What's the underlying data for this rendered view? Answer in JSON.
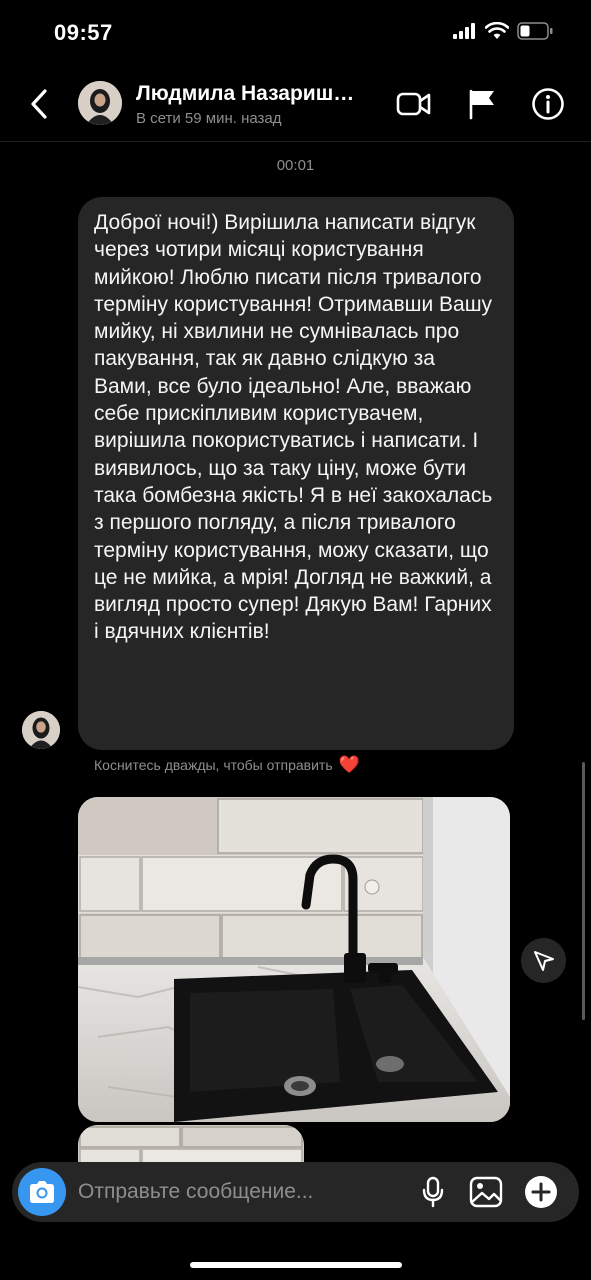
{
  "status_bar": {
    "time": "09:57"
  },
  "header": {
    "name": "Людмила Назариш…",
    "status": "В сети 59 мин. назад"
  },
  "chat": {
    "timestamp": "00:01",
    "message": "Доброї ночі!) Вирішила написати відгук через чотири місяці користування мийкою! Люблю писати після тривалого терміну користування! Отримавши Вашу мийку, ні хвилини не сумнівалась про пакування, так як давно слідкую за Вами, все було ідеально! Але, вважаю себе прискіпливим користувачем, вирішила покористуватись і написати. І виявилось, що за таку ціну, може бути така бомбезна якість! Я в неї закохалась з першого погляду, а після тривалого терміну користування, можу сказати, що це не мийка, а мрія! Догляд  не важкий, а вигляд просто супер! Дякую Вам! Гарних і вдячних клієнтів!",
    "double_tap_hint": "Коснитесь дважды, чтобы отправить",
    "hint_heart": "❤️"
  },
  "composer": {
    "placeholder": "Отправьте сообщение..."
  },
  "colors": {
    "background": "#000000",
    "bubble": "#262626",
    "accent": "#3797f0",
    "muted_text": "#8e8e8e",
    "heart": "#ed3c4c"
  },
  "icons": {
    "back": "chevron-left-icon",
    "video": "video-call-icon",
    "flag": "flag-icon",
    "info": "info-icon",
    "camera": "camera-icon",
    "mic": "microphone-icon",
    "gallery": "gallery-icon",
    "add": "plus-circle-icon",
    "share": "send-icon"
  }
}
